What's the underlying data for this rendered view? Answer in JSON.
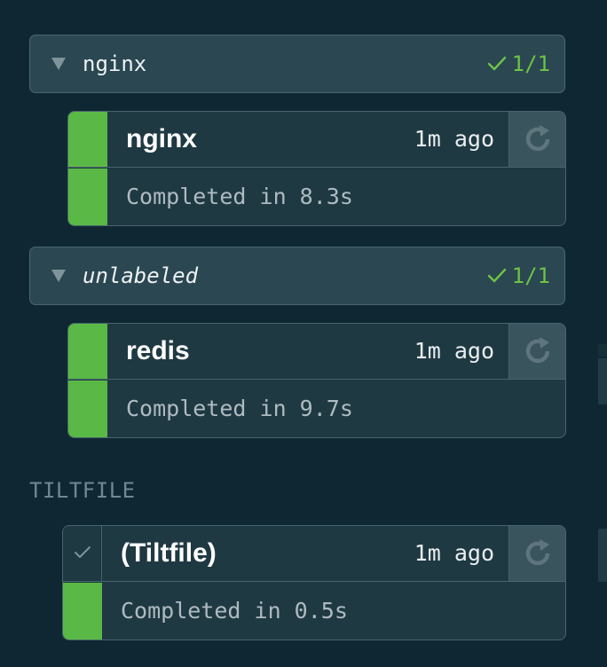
{
  "groups": [
    {
      "name": "nginx",
      "count": "1/1",
      "resource": {
        "name": "nginx",
        "age": "1m ago",
        "status": "Completed in 8.3s"
      }
    },
    {
      "name": "unlabeled",
      "count": "1/1",
      "resource": {
        "name": "redis",
        "age": "1m ago",
        "status": "Completed in 9.7s"
      }
    }
  ],
  "tiltfile_section": {
    "label": "TILTFILE",
    "resource": {
      "name": "(Tiltfile)",
      "age": "1m ago",
      "status": "Completed in 0.5s"
    }
  },
  "colors": {
    "background": "#0f2732",
    "success": "#5ab946",
    "card": "#1f3943",
    "header": "#2a4752"
  },
  "icons": {
    "group_toggle": "caret-down-icon",
    "group_status": "check-icon",
    "trigger": "refresh-icon"
  }
}
